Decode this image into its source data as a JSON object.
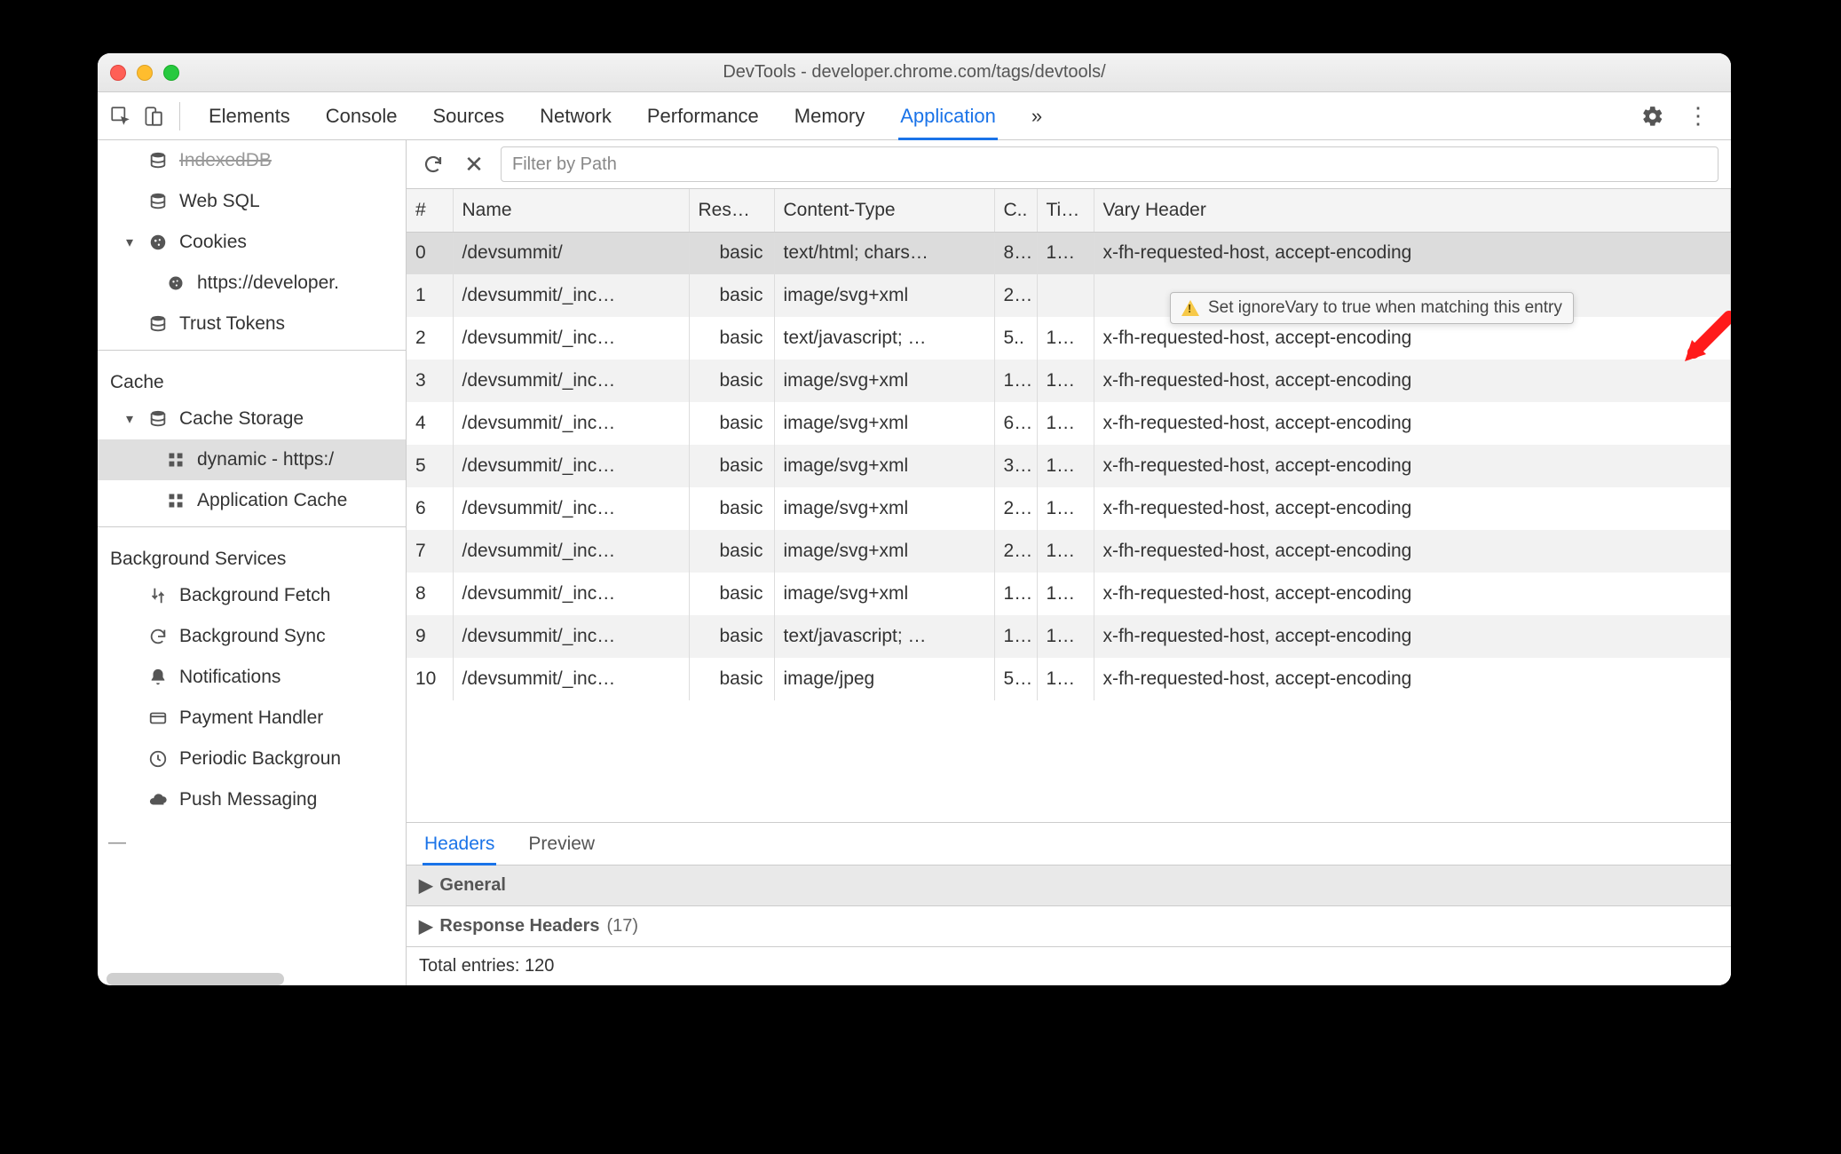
{
  "window": {
    "title": "DevTools - developer.chrome.com/tags/devtools/"
  },
  "tabs": {
    "items": [
      "Elements",
      "Console",
      "Sources",
      "Network",
      "Performance",
      "Memory",
      "Application"
    ],
    "more": "»",
    "active": "Application"
  },
  "sidebar": {
    "items": [
      {
        "icon": "database",
        "label": "IndexedDB",
        "indent": 1
      },
      {
        "icon": "database",
        "label": "Web SQL",
        "indent": 1
      },
      {
        "icon": "cookie",
        "label": "Cookies",
        "indent": 0,
        "expandable": true
      },
      {
        "icon": "cookie",
        "label": "https://developer.",
        "indent": 2
      },
      {
        "icon": "database",
        "label": "Trust Tokens",
        "indent": 1
      }
    ],
    "sections": [
      {
        "title": "Cache"
      },
      {
        "title": "Background Services"
      }
    ],
    "cache_items": [
      {
        "icon": "database",
        "label": "Cache Storage",
        "indent": 0,
        "expandable": true
      },
      {
        "icon": "grid",
        "label": "dynamic - https:/",
        "indent": 2,
        "selected": true
      },
      {
        "icon": "grid",
        "label": "Application Cache",
        "indent": 1
      }
    ],
    "bg_items": [
      {
        "icon": "updown",
        "label": "Background Fetch"
      },
      {
        "icon": "sync",
        "label": "Background Sync"
      },
      {
        "icon": "bell",
        "label": "Notifications"
      },
      {
        "icon": "card",
        "label": "Payment Handler"
      },
      {
        "icon": "clock",
        "label": "Periodic Backgroun"
      },
      {
        "icon": "cloud",
        "label": "Push Messaging"
      }
    ]
  },
  "toolbar": {
    "filter_placeholder": "Filter by Path"
  },
  "table": {
    "columns": [
      "#",
      "Name",
      "Res…",
      "Content-Type",
      "C..",
      "Ti…",
      "Vary Header"
    ],
    "rows": [
      {
        "idx": "0",
        "name": "/devsummit/",
        "resp": "basic",
        "ctype": "text/html; chars…",
        "c": "8…",
        "t": "1…",
        "vary": "x-fh-requested-host, accept-encoding",
        "selected": true
      },
      {
        "idx": "1",
        "name": "/devsummit/_inc…",
        "resp": "basic",
        "ctype": "image/svg+xml",
        "c": "2…",
        "t": "",
        "vary": ""
      },
      {
        "idx": "2",
        "name": "/devsummit/_inc…",
        "resp": "basic",
        "ctype": "text/javascript; …",
        "c": "5..",
        "t": "1…",
        "vary": "x-fh-requested-host, accept-encoding"
      },
      {
        "idx": "3",
        "name": "/devsummit/_inc…",
        "resp": "basic",
        "ctype": "image/svg+xml",
        "c": "1…",
        "t": "1…",
        "vary": "x-fh-requested-host, accept-encoding"
      },
      {
        "idx": "4",
        "name": "/devsummit/_inc…",
        "resp": "basic",
        "ctype": "image/svg+xml",
        "c": "6…",
        "t": "1…",
        "vary": "x-fh-requested-host, accept-encoding"
      },
      {
        "idx": "5",
        "name": "/devsummit/_inc…",
        "resp": "basic",
        "ctype": "image/svg+xml",
        "c": "3…",
        "t": "1…",
        "vary": "x-fh-requested-host, accept-encoding"
      },
      {
        "idx": "6",
        "name": "/devsummit/_inc…",
        "resp": "basic",
        "ctype": "image/svg+xml",
        "c": "2…",
        "t": "1…",
        "vary": "x-fh-requested-host, accept-encoding"
      },
      {
        "idx": "7",
        "name": "/devsummit/_inc…",
        "resp": "basic",
        "ctype": "image/svg+xml",
        "c": "2…",
        "t": "1…",
        "vary": "x-fh-requested-host, accept-encoding"
      },
      {
        "idx": "8",
        "name": "/devsummit/_inc…",
        "resp": "basic",
        "ctype": "image/svg+xml",
        "c": "1…",
        "t": "1…",
        "vary": "x-fh-requested-host, accept-encoding"
      },
      {
        "idx": "9",
        "name": "/devsummit/_inc…",
        "resp": "basic",
        "ctype": "text/javascript; …",
        "c": "1…",
        "t": "1…",
        "vary": "x-fh-requested-host, accept-encoding"
      },
      {
        "idx": "10",
        "name": "/devsummit/_inc…",
        "resp": "basic",
        "ctype": "image/jpeg",
        "c": "5…",
        "t": "1…",
        "vary": "x-fh-requested-host, accept-encoding"
      }
    ]
  },
  "tooltip": {
    "text": "Set ignoreVary to true when matching this entry"
  },
  "subtabs": {
    "items": [
      "Headers",
      "Preview"
    ],
    "active": "Headers"
  },
  "details": {
    "general": "General",
    "response_headers_label": "Response Headers",
    "response_headers_count": "(17)",
    "total_entries": "Total entries: 120"
  }
}
